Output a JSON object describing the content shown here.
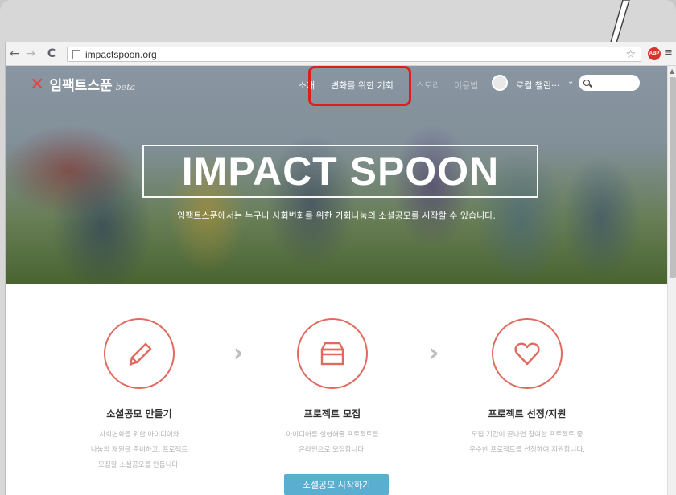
{
  "browser": {
    "url": "impactspoon.org",
    "abp_label": "ABP"
  },
  "site": {
    "logo_text": "임팩트스푼",
    "logo_beta": "beta",
    "nav": {
      "about": "소개",
      "opportunity": "변화를 위한 기회",
      "story": "스토리",
      "guide": "이용법"
    },
    "user_name": "로컬 챌린···",
    "hero_title": "IMPACT SPOON",
    "hero_subtitle": "임팩트스푼에서는 누구나 사회변화를 위한 기회나눔의 소셜공모를 시작할 수 있습니다."
  },
  "steps": [
    {
      "title": "소셜공모 만들기",
      "desc": [
        "사회변화를 위한 아이디어와",
        "나눔의 재원을 준비하고, 프로젝트",
        "모집할 소셜공모를 만듭니다."
      ]
    },
    {
      "title": "프로젝트 모집",
      "desc": [
        "아이디어를 실현해줄 프로젝트를",
        "온라인으로 모집합니다."
      ]
    },
    {
      "title": "프로젝트 선정/지원",
      "desc": [
        "모집 기간이 끝나면 참여한 프로젝트 중",
        "우수한 프로젝트를 선정하여 지원합니다."
      ]
    }
  ],
  "cta_label": "소셜공모 시작하기",
  "colors": {
    "accent": "#e06a5e",
    "highlight": "#e01d1d",
    "cta": "#5aaed0"
  }
}
